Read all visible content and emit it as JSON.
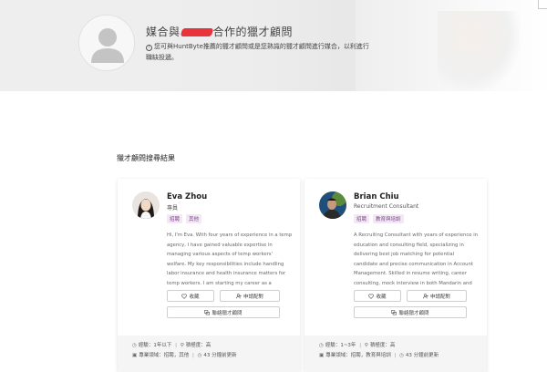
{
  "hero": {
    "title_prefix": "媒合與",
    "title_suffix": "合作的獵才顧問",
    "info_text": "您可與HuntByte推薦的獵才顧問或是您熟識的獵才顧問進行媒合，以利進行職缺投遞。"
  },
  "section_title": "獵才顧問搜尋結果",
  "consultants": [
    {
      "name": "Eva Zhou",
      "role": "專員",
      "tags": [
        "招聘",
        "其他"
      ],
      "bio": "Hi, I'm Eva. With four years of experience in a temp agency, I have gained valuable expertise in managing various aspects of temp workers' welfare. My key responsibilities include handling labor insurance and health insurance matters for temp workers. I am starting my career as a recruiter for b...",
      "favorite_label": "收藏",
      "apply_label": "申請配對",
      "contact_label": "聯絡獵才顧問",
      "experience_label": "經驗：",
      "experience_value": "1年以下",
      "activity_label": "積極度：",
      "activity_value": "高",
      "field_label": "專業領域：",
      "field_value": "招聘，其他",
      "updated": "43 分鐘前更新"
    },
    {
      "name": "Brian Chiu",
      "role": "Recruitment Consultant",
      "tags": [
        "招聘",
        "教育與培訓"
      ],
      "bio": "A Recruiting Consultant with years of experience in education and consulting field, specializing in delivering best job matching for potential candidate and precise communication in Account Management. Skilled in resume writing, career consulting, mock interview in both Mandarin and English. Profi...",
      "favorite_label": "收藏",
      "apply_label": "申請配對",
      "contact_label": "聯絡獵才顧問",
      "experience_label": "經驗：",
      "experience_value": "1~3年",
      "activity_label": "積極度：",
      "activity_value": "高",
      "field_label": "專業領域：",
      "field_value": "招聘，教育與培訓",
      "updated": "43 分鐘前更新"
    }
  ]
}
